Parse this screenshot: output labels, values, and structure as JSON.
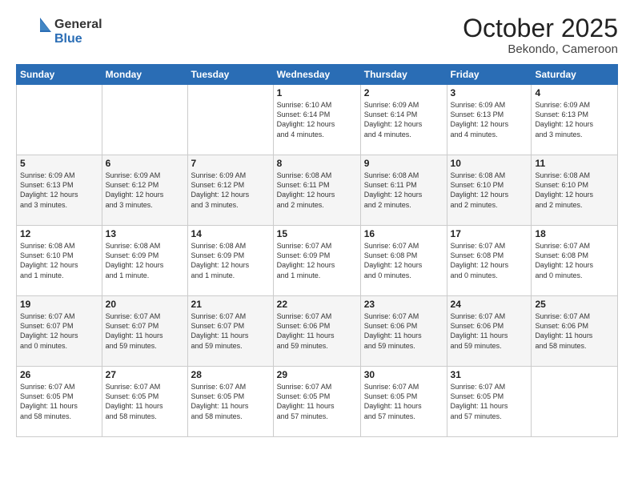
{
  "header": {
    "logo_general": "General",
    "logo_blue": "Blue",
    "month": "October 2025",
    "location": "Bekondo, Cameroon"
  },
  "days_of_week": [
    "Sunday",
    "Monday",
    "Tuesday",
    "Wednesday",
    "Thursday",
    "Friday",
    "Saturday"
  ],
  "weeks": [
    [
      {
        "day": "",
        "info": ""
      },
      {
        "day": "",
        "info": ""
      },
      {
        "day": "",
        "info": ""
      },
      {
        "day": "1",
        "info": "Sunrise: 6:10 AM\nSunset: 6:14 PM\nDaylight: 12 hours\nand 4 minutes."
      },
      {
        "day": "2",
        "info": "Sunrise: 6:09 AM\nSunset: 6:14 PM\nDaylight: 12 hours\nand 4 minutes."
      },
      {
        "day": "3",
        "info": "Sunrise: 6:09 AM\nSunset: 6:13 PM\nDaylight: 12 hours\nand 4 minutes."
      },
      {
        "day": "4",
        "info": "Sunrise: 6:09 AM\nSunset: 6:13 PM\nDaylight: 12 hours\nand 3 minutes."
      }
    ],
    [
      {
        "day": "5",
        "info": "Sunrise: 6:09 AM\nSunset: 6:13 PM\nDaylight: 12 hours\nand 3 minutes."
      },
      {
        "day": "6",
        "info": "Sunrise: 6:09 AM\nSunset: 6:12 PM\nDaylight: 12 hours\nand 3 minutes."
      },
      {
        "day": "7",
        "info": "Sunrise: 6:09 AM\nSunset: 6:12 PM\nDaylight: 12 hours\nand 3 minutes."
      },
      {
        "day": "8",
        "info": "Sunrise: 6:08 AM\nSunset: 6:11 PM\nDaylight: 12 hours\nand 2 minutes."
      },
      {
        "day": "9",
        "info": "Sunrise: 6:08 AM\nSunset: 6:11 PM\nDaylight: 12 hours\nand 2 minutes."
      },
      {
        "day": "10",
        "info": "Sunrise: 6:08 AM\nSunset: 6:10 PM\nDaylight: 12 hours\nand 2 minutes."
      },
      {
        "day": "11",
        "info": "Sunrise: 6:08 AM\nSunset: 6:10 PM\nDaylight: 12 hours\nand 2 minutes."
      }
    ],
    [
      {
        "day": "12",
        "info": "Sunrise: 6:08 AM\nSunset: 6:10 PM\nDaylight: 12 hours\nand 1 minute."
      },
      {
        "day": "13",
        "info": "Sunrise: 6:08 AM\nSunset: 6:09 PM\nDaylight: 12 hours\nand 1 minute."
      },
      {
        "day": "14",
        "info": "Sunrise: 6:08 AM\nSunset: 6:09 PM\nDaylight: 12 hours\nand 1 minute."
      },
      {
        "day": "15",
        "info": "Sunrise: 6:07 AM\nSunset: 6:09 PM\nDaylight: 12 hours\nand 1 minute."
      },
      {
        "day": "16",
        "info": "Sunrise: 6:07 AM\nSunset: 6:08 PM\nDaylight: 12 hours\nand 0 minutes."
      },
      {
        "day": "17",
        "info": "Sunrise: 6:07 AM\nSunset: 6:08 PM\nDaylight: 12 hours\nand 0 minutes."
      },
      {
        "day": "18",
        "info": "Sunrise: 6:07 AM\nSunset: 6:08 PM\nDaylight: 12 hours\nand 0 minutes."
      }
    ],
    [
      {
        "day": "19",
        "info": "Sunrise: 6:07 AM\nSunset: 6:07 PM\nDaylight: 12 hours\nand 0 minutes."
      },
      {
        "day": "20",
        "info": "Sunrise: 6:07 AM\nSunset: 6:07 PM\nDaylight: 11 hours\nand 59 minutes."
      },
      {
        "day": "21",
        "info": "Sunrise: 6:07 AM\nSunset: 6:07 PM\nDaylight: 11 hours\nand 59 minutes."
      },
      {
        "day": "22",
        "info": "Sunrise: 6:07 AM\nSunset: 6:06 PM\nDaylight: 11 hours\nand 59 minutes."
      },
      {
        "day": "23",
        "info": "Sunrise: 6:07 AM\nSunset: 6:06 PM\nDaylight: 11 hours\nand 59 minutes."
      },
      {
        "day": "24",
        "info": "Sunrise: 6:07 AM\nSunset: 6:06 PM\nDaylight: 11 hours\nand 59 minutes."
      },
      {
        "day": "25",
        "info": "Sunrise: 6:07 AM\nSunset: 6:06 PM\nDaylight: 11 hours\nand 58 minutes."
      }
    ],
    [
      {
        "day": "26",
        "info": "Sunrise: 6:07 AM\nSunset: 6:05 PM\nDaylight: 11 hours\nand 58 minutes."
      },
      {
        "day": "27",
        "info": "Sunrise: 6:07 AM\nSunset: 6:05 PM\nDaylight: 11 hours\nand 58 minutes."
      },
      {
        "day": "28",
        "info": "Sunrise: 6:07 AM\nSunset: 6:05 PM\nDaylight: 11 hours\nand 58 minutes."
      },
      {
        "day": "29",
        "info": "Sunrise: 6:07 AM\nSunset: 6:05 PM\nDaylight: 11 hours\nand 57 minutes."
      },
      {
        "day": "30",
        "info": "Sunrise: 6:07 AM\nSunset: 6:05 PM\nDaylight: 11 hours\nand 57 minutes."
      },
      {
        "day": "31",
        "info": "Sunrise: 6:07 AM\nSunset: 6:05 PM\nDaylight: 11 hours\nand 57 minutes."
      },
      {
        "day": "",
        "info": ""
      }
    ]
  ]
}
